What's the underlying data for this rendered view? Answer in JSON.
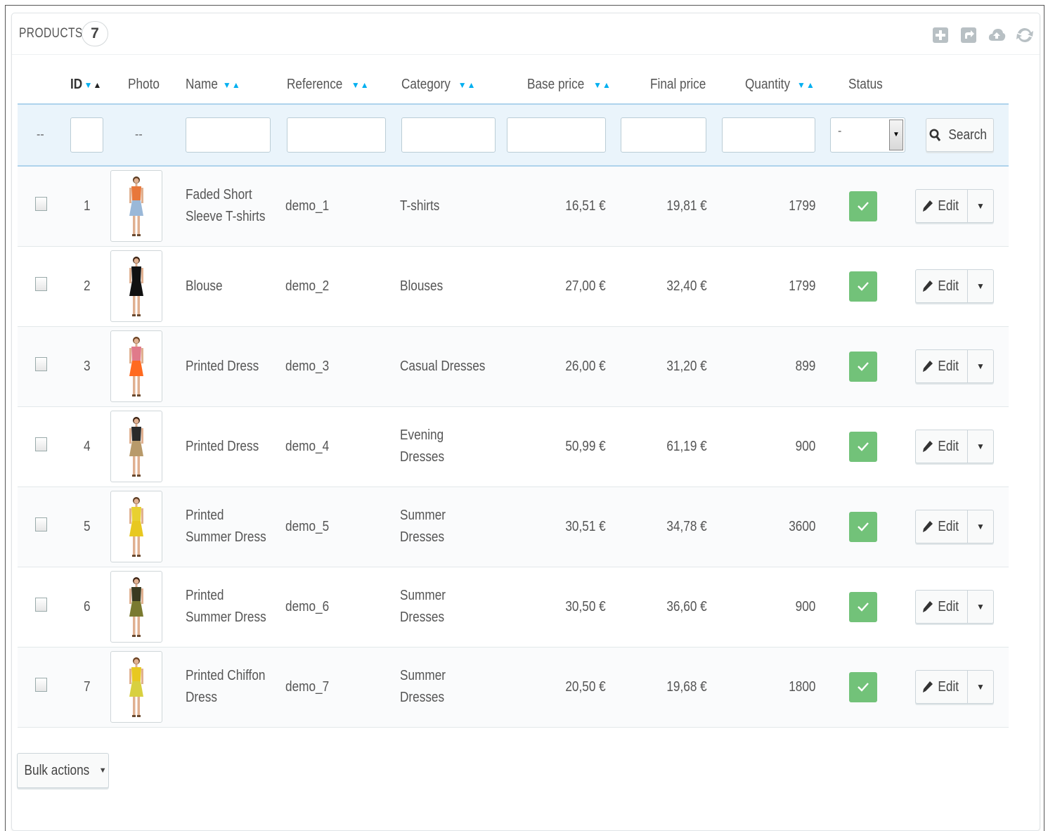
{
  "panel": {
    "title": "PRODUCTS",
    "count": "7"
  },
  "header_icons": [
    "add-icon",
    "export-icon",
    "upload-icon",
    "refresh-icon"
  ],
  "columns": {
    "id": "ID",
    "photo": "Photo",
    "name": "Name",
    "reference": "Reference",
    "category": "Category",
    "base_price": "Base price",
    "final_price": "Final price",
    "quantity": "Quantity",
    "status": "Status"
  },
  "filter": {
    "dash": "--",
    "status_value": "-",
    "search_label": "Search"
  },
  "rows": [
    {
      "id": "1",
      "name": "Faded Short Sleeve T-shirts",
      "reference": "demo_1",
      "category": "T-shirts",
      "base_price": "16,51 €",
      "final_price": "19,81 €",
      "quantity": "1799"
    },
    {
      "id": "2",
      "name": "Blouse",
      "reference": "demo_2",
      "category": "Blouses",
      "base_price": "27,00 €",
      "final_price": "32,40 €",
      "quantity": "1799"
    },
    {
      "id": "3",
      "name": "Printed Dress",
      "reference": "demo_3",
      "category": "Casual Dresses",
      "base_price": "26,00 €",
      "final_price": "31,20 €",
      "quantity": "899"
    },
    {
      "id": "4",
      "name": "Printed Dress",
      "reference": "demo_4",
      "category": "Evening Dresses",
      "base_price": "50,99 €",
      "final_price": "61,19 €",
      "quantity": "900"
    },
    {
      "id": "5",
      "name": "Printed Summer Dress",
      "reference": "demo_5",
      "category": "Summer Dresses",
      "base_price": "30,51 €",
      "final_price": "34,78 €",
      "quantity": "3600"
    },
    {
      "id": "6",
      "name": "Printed Summer Dress",
      "reference": "demo_6",
      "category": "Summer Dresses",
      "base_price": "30,50 €",
      "final_price": "36,60 €",
      "quantity": "900"
    },
    {
      "id": "7",
      "name": "Printed Chiffon Dress",
      "reference": "demo_7",
      "category": "Summer Dresses",
      "base_price": "20,50 €",
      "final_price": "19,68 €",
      "quantity": "1800"
    }
  ],
  "row_action": {
    "edit_label": "Edit"
  },
  "bulk_actions_label": "Bulk actions",
  "colors": {
    "accent": "#00aff0",
    "status_green": "#72c279",
    "filter_bg": "#eaf4fb"
  }
}
